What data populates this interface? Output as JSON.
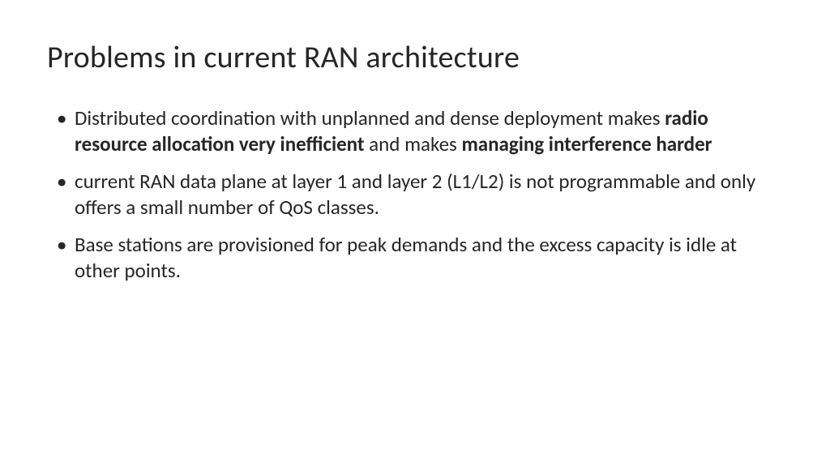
{
  "slide": {
    "title": "Problems in current RAN architecture",
    "bullets": [
      {
        "runs": [
          {
            "text": "Distributed coordination with unplanned and dense deployment makes ",
            "bold": false
          },
          {
            "text": "radio resource allocation very inefficient ",
            "bold": true
          },
          {
            "text": "and makes ",
            "bold": false
          },
          {
            "text": "managing interference harder",
            "bold": true
          }
        ]
      },
      {
        "runs": [
          {
            "text": "current RAN data plane at layer 1 and layer 2 (L1/L2) is not programmable and only offers a small number of QoS classes.",
            "bold": false
          }
        ]
      },
      {
        "runs": [
          {
            "text": "Base stations are provisioned for peak demands and the excess capacity is idle at other points.",
            "bold": false
          }
        ]
      }
    ]
  }
}
